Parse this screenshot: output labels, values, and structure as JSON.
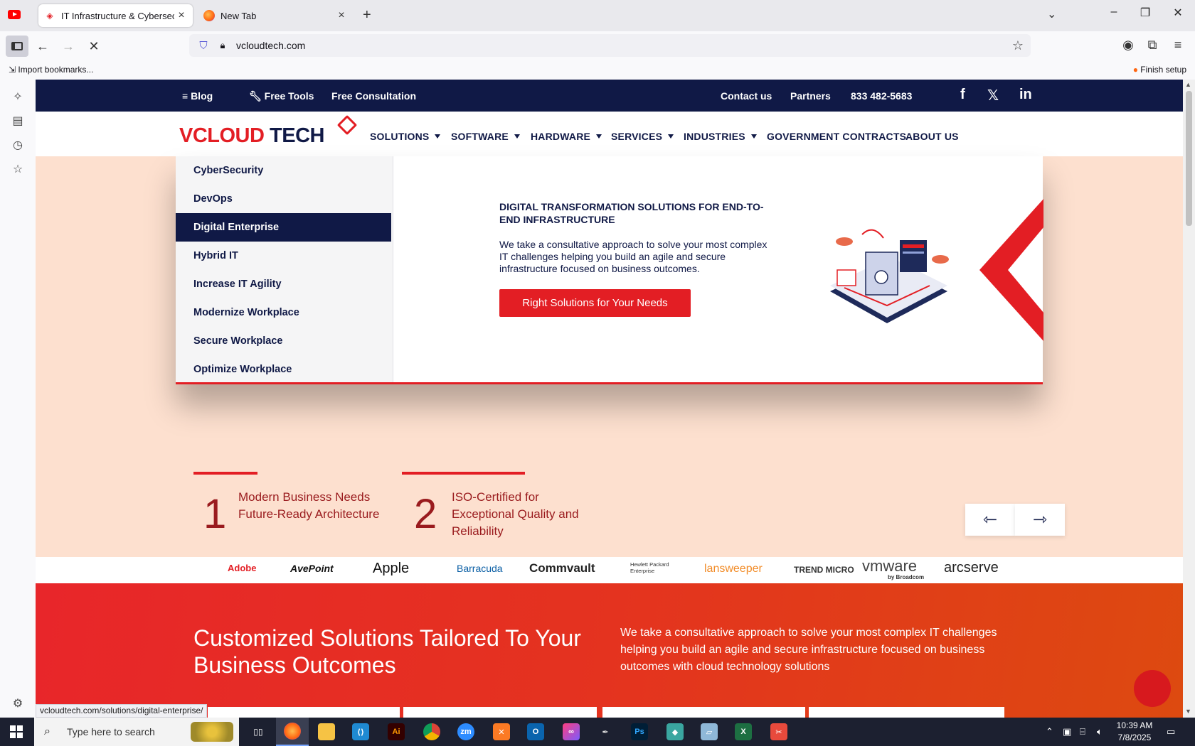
{
  "browser": {
    "tabs": [
      {
        "title": "IT Infrastructure & Cybersecurit",
        "active": true
      },
      {
        "title": "New Tab",
        "active": false
      }
    ],
    "url": "vcloudtech.com",
    "bookmarks": {
      "import_label": "Import bookmarks...",
      "finish_label": "Finish setup"
    },
    "status_url": "vcloudtech.com/solutions/digital-enterprise/"
  },
  "site": {
    "topbar": {
      "blog": "Blog",
      "free_tools": "Free Tools",
      "free_consultation": "Free Consultation",
      "contact": "Contact us",
      "partners": "Partners",
      "phone": "833 482-5683",
      "facebook_glyph": "f",
      "x_glyph": "𝕏",
      "linkedin_glyph": "in"
    },
    "logo": {
      "v": "V",
      "cloud": "CLOUD",
      "tech": " TECH"
    },
    "nav": {
      "solutions": "SOLUTIONS",
      "software": "SOFTWARE",
      "hardware": "HARDWARE",
      "services": "SERVICES",
      "industries": "INDUSTRIES",
      "government": "GOVERNMENT CONTRACTS",
      "about": "ABOUT US"
    },
    "megamenu": {
      "items": [
        "CyberSecurity",
        "DevOps",
        "Digital Enterprise",
        "Hybrid IT",
        "Increase IT Agility",
        "Modernize Workplace",
        "Secure Workplace",
        "Optimize Workplace"
      ],
      "active_index": 2,
      "heading": "DIGITAL TRANSFORMATION SOLUTIONS FOR END-TO-END INFRASTRUCTURE",
      "description": "We take a consultative approach to solve your most complex IT challenges helping you build an agile and secure infrastructure focused on business outcomes.",
      "cta": "Right Solutions for Your Needs"
    },
    "features": [
      {
        "number": "1",
        "text": "Modern Business Needs Future-Ready Architecture"
      },
      {
        "number": "2",
        "text": "ISO-Certified for Exceptional Quality and Reliability"
      }
    ],
    "arrows": {
      "prev": "⇽",
      "next": "⇾"
    },
    "brands": [
      "Adobe",
      "AvePoint",
      "Apple",
      "Barracuda",
      "Commvault",
      "Hewlett Packard Enterprise",
      "lansweeper",
      "TREND MICRO",
      "vmware",
      "by Broadcom",
      "arcserve"
    ],
    "red_section": {
      "title": "Customized Solutions Tailored To Your Business Outcomes",
      "description": "We take a consultative approach to solve your most complex IT challenges helping you build an agile and secure infrastructure focused on business outcomes with cloud technology solutions"
    }
  },
  "taskbar": {
    "search_placeholder": "Type here to search",
    "time": "10:39 AM",
    "date": "7/8/2025",
    "apps": [
      "Ai",
      "zm",
      "Ps"
    ]
  },
  "colors": {
    "navy": "#101946",
    "red": "#e31e24",
    "peach": "#fde0cf"
  }
}
